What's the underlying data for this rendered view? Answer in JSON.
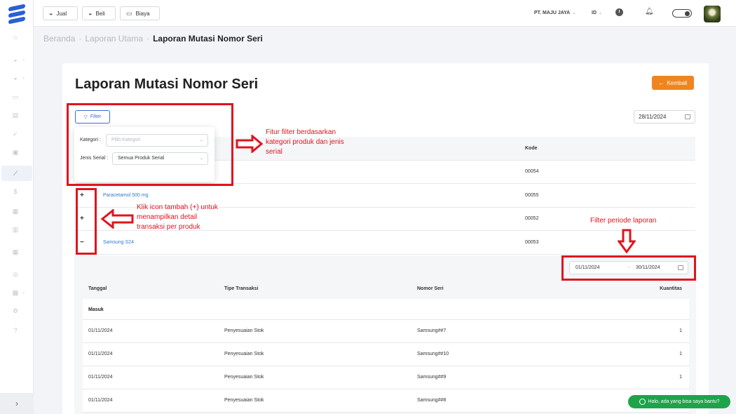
{
  "topbar": {
    "buttons": [
      {
        "label": "Jual",
        "icon": "basket-icon"
      },
      {
        "label": "Beli",
        "icon": "basket-icon"
      },
      {
        "label": "Biaya",
        "icon": "card-icon"
      }
    ],
    "company": "PT. MAJU JAYA",
    "language": "ID"
  },
  "breadcrumb": {
    "items": [
      "Beranda",
      "Laporan Utama",
      "Laporan Mutasi Nomor Seri"
    ]
  },
  "page": {
    "title": "Laporan Mutasi Nomor Seri",
    "back_label": "Kembali",
    "filter_label": "Filter",
    "date": "28/11/2024"
  },
  "filter": {
    "kategori_label": "Kategori :",
    "kategori_placeholder": "Pilih Kategori",
    "jenis_label": "Jenis Serial :",
    "jenis_value": "Semua Produk Serial"
  },
  "table": {
    "kode_header": "Kode",
    "rows": [
      {
        "expander": "",
        "name": "",
        "code": "00054"
      },
      {
        "expander": "+",
        "name": "Paracetamol 500 mg",
        "code": "00055"
      },
      {
        "expander": "+",
        "name": "",
        "code": "00052"
      },
      {
        "expander": "−",
        "name": "Samsung S24",
        "code": "00053"
      }
    ]
  },
  "detail": {
    "range_start": "01/11/2024",
    "range_end": "30/11/2024",
    "range_arrow": "→",
    "headers": [
      "Tanggal",
      "Tipe Transaksi",
      "Nomor Seri",
      "Kuantitas"
    ],
    "section": "Masuk",
    "rows": [
      {
        "date": "01/11/2024",
        "type": "Penyesuaian Stok",
        "serial": "Samsung##7",
        "qty": "1"
      },
      {
        "date": "01/11/2024",
        "type": "Penyesuaian Stok",
        "serial": "Samsung##10",
        "qty": "1"
      },
      {
        "date": "01/11/2024",
        "type": "Penyesuaian Stok",
        "serial": "Samsung##9",
        "qty": "1"
      },
      {
        "date": "01/11/2024",
        "type": "Penyesuaian Stok",
        "serial": "Samsung##8",
        "qty": ""
      }
    ]
  },
  "annotations": {
    "filter_note": [
      "Fitur filter berdasarkan",
      "kategori produk dan jenis",
      "serial"
    ],
    "expand_note": [
      "Klik icon tambah (+) untuk",
      "menampilkan detail",
      "transaksi per produk"
    ],
    "period_note": "Filter periode laporan",
    "color": "#e0141e"
  },
  "whatsapp": {
    "label": "Halo, ada yang bisa saya bantu?"
  },
  "colors": {
    "accent": "#2c5fd6",
    "back_button": "#f0851f",
    "link": "#2c7ad6",
    "whatsapp": "#1fa34a"
  }
}
